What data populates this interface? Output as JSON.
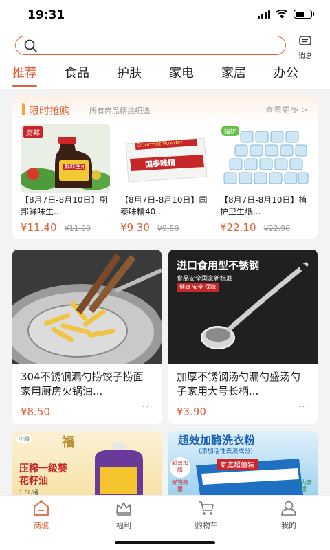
{
  "status": {
    "time": "19:31"
  },
  "header": {
    "search_placeholder": "",
    "message_label": "消息"
  },
  "tabs": [
    {
      "label": "推荐"
    },
    {
      "label": "食品"
    },
    {
      "label": "护肤"
    },
    {
      "label": "家电"
    },
    {
      "label": "家居"
    },
    {
      "label": "办公"
    }
  ],
  "flash_sale": {
    "title": "限时抢购",
    "subtitle": "所有商品精挑细选",
    "more_label": "查看更多 >",
    "items": [
      {
        "name": "【8月7日-8月10日】厨邦鲜味生...",
        "price": "¥11.40",
        "old_price": "¥11.90",
        "brand_label": "厨邦",
        "product_text": "鲜味生抽"
      },
      {
        "name": "【8月7日-8月10日】国泰味精40...",
        "price": "¥9.30",
        "old_price": "¥9.50",
        "brand_label": "Gourmet Powder",
        "product_text": "国泰味精"
      },
      {
        "name": "【8月7日-8月10日】植护卫生纸...",
        "price": "¥22.10",
        "old_price": "¥22.90",
        "brand_label": "植护",
        "product_text": ""
      }
    ]
  },
  "products": [
    {
      "title": "304不锈钢漏勺捞饺子捞面家用厨房火锅油...",
      "price": "¥8.50",
      "more": "···",
      "banner": "",
      "banner_sub": "",
      "banner_tag": ""
    },
    {
      "title": "加厚不锈钢汤勺漏勺盛汤勺子家用大号长柄...",
      "price": "¥3.90",
      "more": "···",
      "banner": "进口食用型不锈钢",
      "banner_sub": "食品安全国家新标准",
      "banner_tag": "健康 安全 保障"
    },
    {
      "title": "",
      "price": "",
      "banner": "压榨一级葵花籽油",
      "banner_sub": "1.8L/桶",
      "brand": "中粮",
      "logo": "福"
    },
    {
      "title": "",
      "price": "",
      "banner": "超效加酶洗衣粉",
      "banner_sub": "(添加活性去渍成分)",
      "banner_tag": "家庭超值装",
      "badges": [
        "超效加酶",
        "鲜艳亮丽",
        "活力去渍"
      ]
    }
  ],
  "bottom_nav": [
    {
      "label": "商城",
      "active": true
    },
    {
      "label": "福利",
      "active": false
    },
    {
      "label": "购物车",
      "active": false
    },
    {
      "label": "我的",
      "active": false
    }
  ],
  "colors": {
    "accent": "#e0623a",
    "gold": "#f2a83a"
  }
}
